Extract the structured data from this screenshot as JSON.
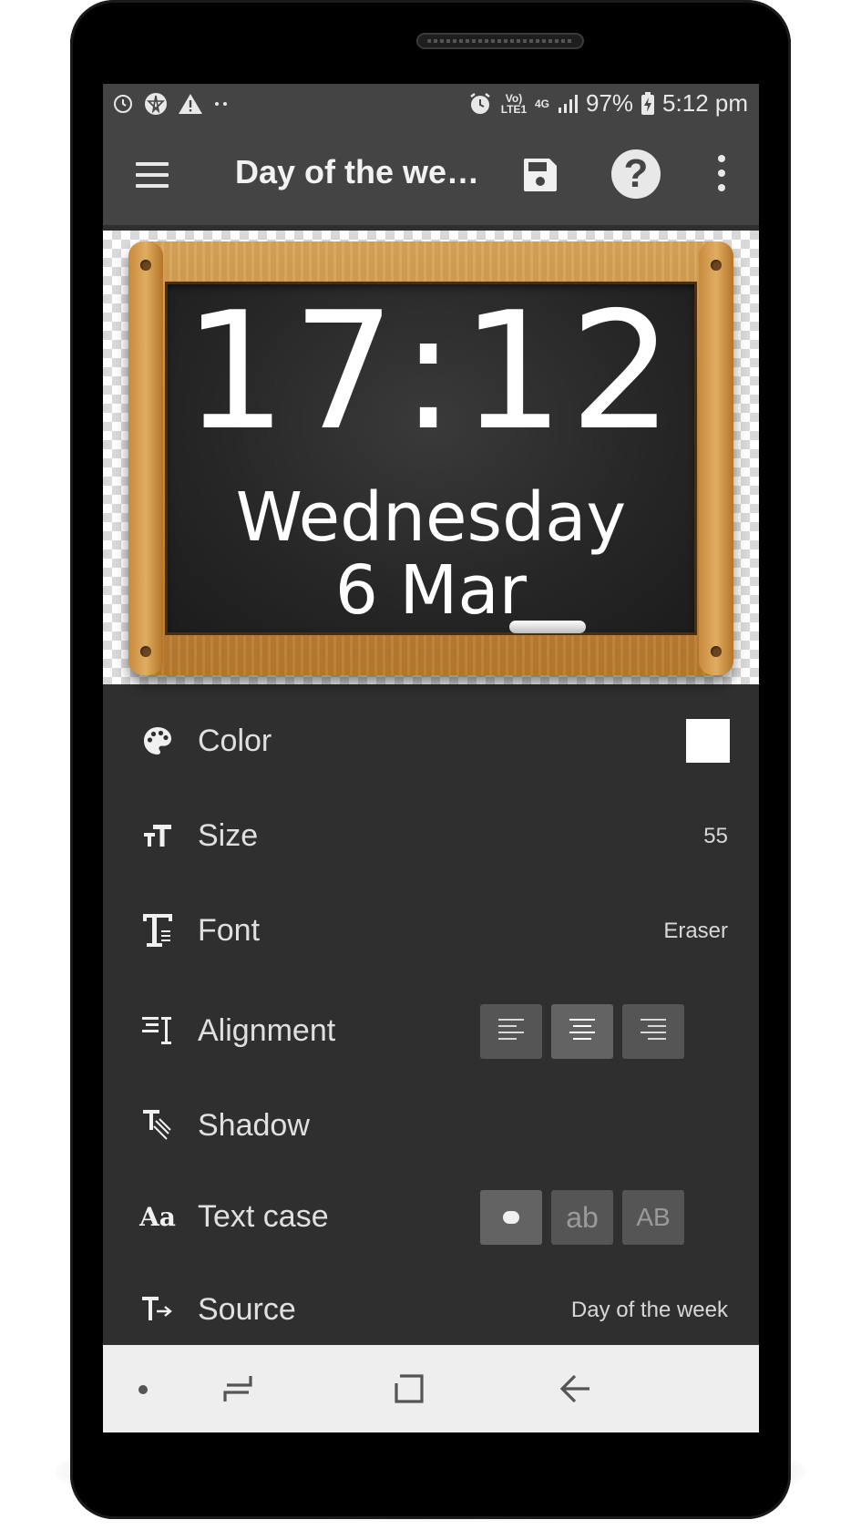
{
  "status_bar": {
    "network": "Vo) LTE1",
    "data": "4G",
    "battery": "97%",
    "time": "5:12 pm"
  },
  "toolbar": {
    "title": "Day of the we…"
  },
  "preview": {
    "time": "17:12",
    "day": "Wednesday",
    "date": "6 Mar"
  },
  "settings": {
    "color": {
      "label": "Color",
      "value_color": "#ffffff"
    },
    "size": {
      "label": "Size",
      "value": "55"
    },
    "font": {
      "label": "Font",
      "value": "Eraser"
    },
    "alignment": {
      "label": "Alignment",
      "options": [
        "left",
        "center",
        "right"
      ],
      "selected": "center"
    },
    "shadow": {
      "label": "Shadow"
    },
    "text_case": {
      "label": "Text case",
      "options": [
        "",
        "ab",
        "AB"
      ],
      "selected": 0
    },
    "source": {
      "label": "Source",
      "value": "Day of the week"
    }
  },
  "colors": {
    "toolbar": "#444444",
    "background": "#2f2f2f",
    "navbar": "#eeeeee"
  }
}
